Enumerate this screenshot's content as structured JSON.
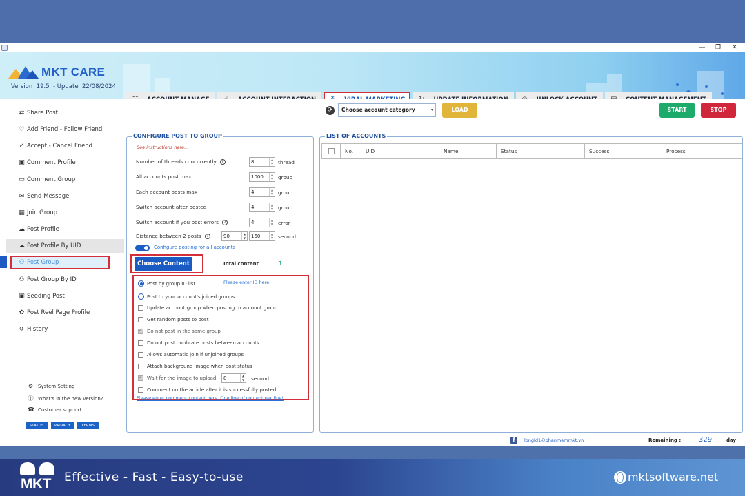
{
  "window": {
    "controls": {
      "minimize": "—",
      "maximize": "❐",
      "close": "✕"
    }
  },
  "app": {
    "name": "MKT CARE",
    "version_label": "Version",
    "version": "19.5",
    "update_label": "- Update",
    "update_date": "22/08/2024"
  },
  "tabs": [
    {
      "label": "ACCOUNT MANAGE",
      "icon": "list-search-icon",
      "glyph": "☷",
      "active": false
    },
    {
      "label": "ACCOUNT INTERACTION",
      "icon": "hand-pointer-icon",
      "glyph": "☝",
      "active": false
    },
    {
      "label": "VIRAL MARKETING",
      "icon": "share-nodes-icon",
      "glyph": "⁂",
      "active": true
    },
    {
      "label": "UPDATE INFORMATION",
      "icon": "refresh-check-icon",
      "glyph": "↻",
      "active": false
    },
    {
      "label": "UNLOCK ACCOUNT",
      "icon": "fingerprint-icon",
      "glyph": "◎",
      "active": false
    },
    {
      "label": "CONTENT MANAGEMENT",
      "icon": "document-icon",
      "glyph": "▤",
      "active": false
    }
  ],
  "toolbar": {
    "refresh_glyph": "⟳",
    "category_select": {
      "value": "Choose account category",
      "caret": "▾"
    },
    "load": "LOAD",
    "start": "START",
    "stop": "STOP"
  },
  "sidebar": {
    "items": [
      {
        "label": "Share Post",
        "glyph": "⇄",
        "icon": "share-arrows-icon"
      },
      {
        "label": "Add Friend - Follow Friend",
        "glyph": "♡",
        "icon": "add-friend-icon"
      },
      {
        "label": "Accept - Cancel Friend",
        "glyph": "✓",
        "icon": "check-circle-icon"
      },
      {
        "label": "Comment Profile",
        "glyph": "▣",
        "icon": "profile-comment-icon"
      },
      {
        "label": "Comment Group",
        "glyph": "▭",
        "icon": "comment-group-icon"
      },
      {
        "label": "Send Message",
        "glyph": "✉",
        "icon": "message-icon"
      },
      {
        "label": "Join Group",
        "glyph": "▦",
        "icon": "join-group-icon"
      },
      {
        "label": "Post Profile",
        "glyph": "☁",
        "icon": "cloud-upload-icon"
      },
      {
        "label": "Post Profile By UID",
        "glyph": "☁",
        "icon": "cloud-upload-icon"
      },
      {
        "label": "Post Group",
        "glyph": "⚇",
        "icon": "post-group-icon"
      },
      {
        "label": "Post Group By ID",
        "glyph": "⚇",
        "icon": "post-group-id-icon"
      },
      {
        "label": "Seeding Post",
        "glyph": "▣",
        "icon": "seeding-post-icon"
      },
      {
        "label": "Post Reel Page Profile",
        "glyph": "✿",
        "icon": "reel-icon"
      },
      {
        "label": "History",
        "glyph": "↺",
        "icon": "history-icon"
      }
    ],
    "active_index": 9,
    "hover_index": 8,
    "bottom": [
      {
        "label": "System Setting",
        "glyph": "⚙",
        "icon": "gear-icon"
      },
      {
        "label": "What's in the new version?",
        "glyph": "ⓘ",
        "icon": "info-icon"
      },
      {
        "label": "Customer support",
        "glyph": "☎",
        "icon": "support-icon"
      }
    ],
    "pills": [
      "STATUS",
      "PRIVACY",
      "TERMS"
    ]
  },
  "config": {
    "title": "CONFIGURE POST TO GROUP",
    "instructions_link": "See instructions here...",
    "rows": [
      {
        "label": "Number of threads concurrently",
        "help": true,
        "value": "8",
        "unit": "thread"
      },
      {
        "label": "All accounts post max",
        "help": false,
        "value": "1000",
        "unit": "group"
      },
      {
        "label": "Each account posts max",
        "help": false,
        "value": "4",
        "unit": "group"
      },
      {
        "label": "Switch account after posted",
        "help": false,
        "value": "4",
        "unit": "group"
      },
      {
        "label": "Switch account if you post errors",
        "help": true,
        "value": "4",
        "unit": "error"
      }
    ],
    "distance": {
      "label": "Distance between 2 posts",
      "min": "90",
      "max": "160",
      "unit": "second"
    },
    "toggle_label": "Configure posting for all accounts",
    "toggle_on": true,
    "choose_content": "Choose Content",
    "total_content_label": "Total content",
    "total_content_value": "1",
    "options": {
      "radio_group_ids": {
        "label": "Post by group ID list",
        "checked": true
      },
      "enter_id_link": "Please enter ID here!",
      "radio_joined": {
        "label": "Post to your account's joined groups",
        "checked": false
      },
      "checks": [
        {
          "label": "Update account group when posting to account group",
          "checked": false,
          "disabled": false
        },
        {
          "label": "Get random posts to post",
          "checked": false,
          "disabled": false
        },
        {
          "label": "Do not post in the same group",
          "checked": true,
          "disabled": true
        },
        {
          "label": "Do not post duplicate posts between accounts",
          "checked": false,
          "disabled": false
        },
        {
          "label": "Allows automatic join if unjoined groups",
          "checked": false,
          "disabled": false
        },
        {
          "label": "Attach background image when post status",
          "checked": false,
          "disabled": false
        },
        {
          "label": "Wait for the image to upload",
          "checked": true,
          "disabled": true,
          "value": "8",
          "unit": "second"
        },
        {
          "label": "Comment on the article after it is successfully posted",
          "checked": false,
          "disabled": false
        }
      ],
      "comment_link": "Please enter comment content here. One line of content per line!"
    }
  },
  "accounts": {
    "title": "LIST OF ACCOUNTS",
    "columns": [
      "",
      "No.",
      "UID",
      "Name",
      "Status",
      "Success",
      "Process"
    ],
    "rows": []
  },
  "status_bar": {
    "email": "longld1@phanmemmkt.vn",
    "remaining_label": "Remaining :",
    "remaining_value": "329",
    "remaining_unit": "day"
  },
  "footer": {
    "logo_text": "MKT",
    "slogan": "Effective - Fast - Easy-to-use",
    "website": "mktsoftware.net"
  }
}
